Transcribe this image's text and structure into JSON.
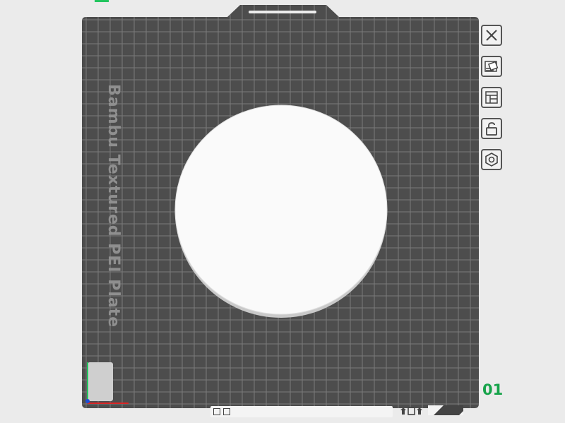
{
  "plate": {
    "label": "Bambu Textured PEI Plate",
    "number": "01"
  },
  "toolbar": {
    "buttons": [
      {
        "name": "close",
        "icon": "close-icon"
      },
      {
        "name": "arrange",
        "icon": "arrange-icon"
      },
      {
        "name": "plate-settings",
        "icon": "layout-icon"
      },
      {
        "name": "lock",
        "icon": "unlock-icon"
      },
      {
        "name": "settings",
        "icon": "hex-nut-icon"
      }
    ]
  },
  "colors": {
    "plate": "#4d4d4d",
    "grid": "#7a7a7a",
    "object": "#fafafa",
    "accent": "#16a34a"
  }
}
